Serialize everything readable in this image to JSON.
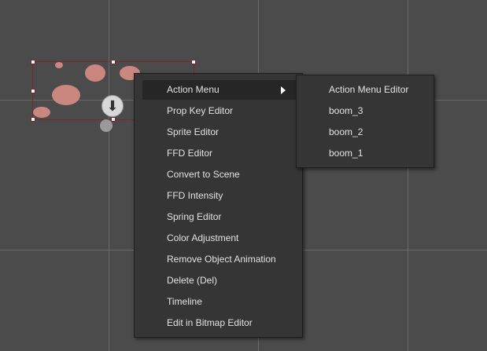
{
  "context_menu": {
    "items": [
      {
        "label": "Action Menu",
        "has_submenu": true
      },
      {
        "label": "Prop Key Editor"
      },
      {
        "label": "Sprite Editor"
      },
      {
        "label": "FFD Editor"
      },
      {
        "label": "Convert to Scene"
      },
      {
        "label": "FFD Intensity"
      },
      {
        "label": "Spring Editor"
      },
      {
        "label": "Color Adjustment"
      },
      {
        "label": "Remove Object Animation"
      },
      {
        "label": "Delete (Del)"
      },
      {
        "label": "Timeline"
      },
      {
        "label": "Edit in Bitmap Editor"
      }
    ]
  },
  "submenu": {
    "items": [
      {
        "label": "Action Menu Editor"
      },
      {
        "label": "boom_3"
      },
      {
        "label": "boom_2"
      },
      {
        "label": "boom_1"
      }
    ]
  },
  "colors": {
    "background": "#4b4b4b",
    "menu": "#353535",
    "selection": "#7a2a2a",
    "sprite": "#c98780"
  }
}
